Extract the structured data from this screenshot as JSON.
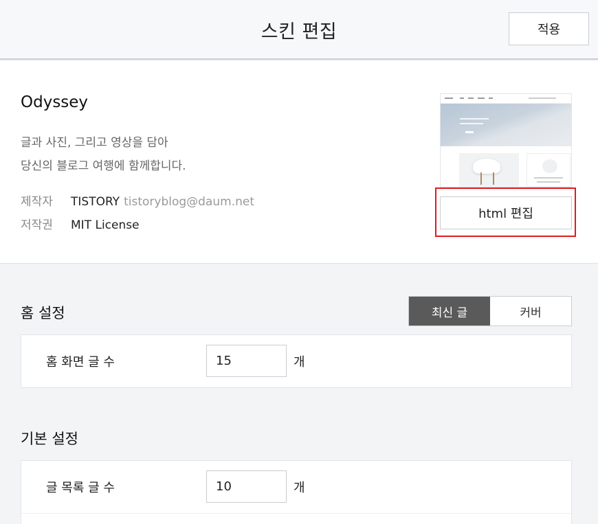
{
  "header": {
    "title": "스킨 편집",
    "apply_label": "적용"
  },
  "skin": {
    "name": "Odyssey",
    "description_line1": "글과 사진, 그리고 영상을 담아",
    "description_line2": "당신의 블로그 여행에 함께합니다.",
    "author_label": "제작자",
    "author_name": "TISTORY",
    "author_email": "tistoryblog@daum.net",
    "license_label": "저작권",
    "license_value": "MIT License",
    "html_edit_label": "html 편집"
  },
  "home_settings": {
    "title": "홈 설정",
    "toggle": [
      {
        "label": "최신 글",
        "active": true
      },
      {
        "label": "커버",
        "active": false
      }
    ],
    "post_count_label": "홈 화면 글 수",
    "post_count_value": "15",
    "unit": "개"
  },
  "base_settings": {
    "title": "기본 설정",
    "list_count_label": "글 목록 글 수",
    "list_count_value": "10",
    "unit": "개"
  },
  "colors": {
    "highlight": "#e0191f",
    "toggle_active": "#5a5a5a"
  }
}
